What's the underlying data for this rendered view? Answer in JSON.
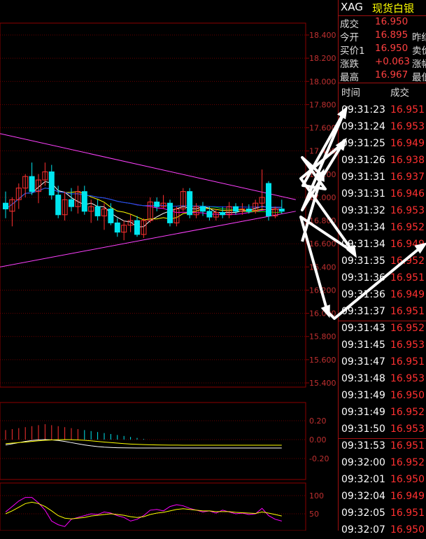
{
  "colors": {
    "background": "#000000",
    "grid": "#8b0000",
    "axis_label": "#c03030",
    "up": "#ff3030",
    "down": "#00e5ee",
    "ma5": "#ffffff",
    "ma10": "#ffff00",
    "ma20": "#ff00ff",
    "ma30": "#00cc00",
    "ma60": "#2040ff",
    "trendline": "#ff40ff",
    "arrow": "#ffffff"
  },
  "quote": {
    "symbol": "XAG",
    "name": "现货白银",
    "rows": [
      {
        "label": "成交",
        "value": "16.950",
        "label2": ""
      },
      {
        "label": "今开",
        "value": "16.895",
        "label2": "昨结"
      },
      {
        "label": "买价1",
        "value": "16.950",
        "label2": "卖价"
      },
      {
        "label": "涨跌",
        "value": "+0.063",
        "label2": "涨幅"
      },
      {
        "label": "最高",
        "value": "16.967",
        "label2": "最低"
      }
    ]
  },
  "ticks": {
    "header_time": "时间",
    "header_price": "成交",
    "rows": [
      {
        "time": "09:31:23",
        "price": "16.951"
      },
      {
        "time": "09:31:24",
        "price": "16.953"
      },
      {
        "time": "09:31:25",
        "price": "16.949"
      },
      {
        "time": "09:31:26",
        "price": "16.938"
      },
      {
        "time": "09:31:31",
        "price": "16.937"
      },
      {
        "time": "09:31:31",
        "price": "16.946"
      },
      {
        "time": "09:31:32",
        "price": "16.953"
      },
      {
        "time": "09:31:34",
        "price": "16.952"
      },
      {
        "time": "09:31:34",
        "price": "16.949"
      },
      {
        "time": "09:31:35",
        "price": "16.952"
      },
      {
        "time": "09:31:36",
        "price": "16.951"
      },
      {
        "time": "09:31:36",
        "price": "16.949"
      },
      {
        "time": "09:31:37",
        "price": "16.951"
      },
      {
        "time": "09:31:43",
        "price": "16.952"
      },
      {
        "time": "09:31:45",
        "price": "16.953"
      },
      {
        "time": "09:31:47",
        "price": "16.951"
      },
      {
        "time": "09:31:48",
        "price": "16.953"
      },
      {
        "time": "09:31:49",
        "price": "16.950"
      },
      {
        "time": "09:31:49",
        "price": "16.952"
      },
      {
        "time": "09:31:50",
        "price": "16.953"
      },
      {
        "time": "09:31:53",
        "price": "16.951"
      },
      {
        "time": "09:32:00",
        "price": "16.952"
      },
      {
        "time": "09:32:01",
        "price": "16.950"
      },
      {
        "time": "09:32:04",
        "price": "16.949"
      },
      {
        "time": "09:32:05",
        "price": "16.951"
      },
      {
        "time": "09:32:07",
        "price": "16.950"
      }
    ]
  },
  "chart_data": [
    {
      "type": "candlestick",
      "title": "",
      "y_ticks": [
        "18.400",
        "18.200",
        "18.000",
        "17.800",
        "17.600",
        "17.400",
        "17.200",
        "17.000",
        "16.800",
        "16.600",
        "16.400",
        "16.200",
        "16.000",
        "15.800",
        "15.600",
        "15.400"
      ],
      "ylim": [
        15.4,
        18.5
      ],
      "candles": [
        {
          "o": 16.95,
          "h": 17.05,
          "l": 16.82,
          "c": 16.9
        },
        {
          "o": 16.88,
          "h": 17.0,
          "l": 16.75,
          "c": 16.98
        },
        {
          "o": 16.98,
          "h": 17.12,
          "l": 16.9,
          "c": 17.08
        },
        {
          "o": 17.08,
          "h": 17.2,
          "l": 17.0,
          "c": 17.18
        },
        {
          "o": 17.18,
          "h": 17.3,
          "l": 17.02,
          "c": 17.05
        },
        {
          "o": 17.05,
          "h": 17.2,
          "l": 16.95,
          "c": 17.15
        },
        {
          "o": 17.15,
          "h": 17.3,
          "l": 17.1,
          "c": 17.22
        },
        {
          "o": 17.22,
          "h": 17.28,
          "l": 16.98,
          "c": 17.02
        },
        {
          "o": 17.02,
          "h": 17.1,
          "l": 16.82,
          "c": 16.85
        },
        {
          "o": 16.85,
          "h": 17.05,
          "l": 16.8,
          "c": 16.98
        },
        {
          "o": 16.98,
          "h": 17.08,
          "l": 16.88,
          "c": 16.92
        },
        {
          "o": 16.92,
          "h": 17.1,
          "l": 16.86,
          "c": 17.05
        },
        {
          "o": 17.05,
          "h": 17.1,
          "l": 16.85,
          "c": 16.88
        },
        {
          "o": 16.88,
          "h": 16.98,
          "l": 16.78,
          "c": 16.92
        },
        {
          "o": 16.92,
          "h": 16.98,
          "l": 16.8,
          "c": 16.84
        },
        {
          "o": 16.84,
          "h": 16.95,
          "l": 16.72,
          "c": 16.9
        },
        {
          "o": 16.9,
          "h": 16.95,
          "l": 16.76,
          "c": 16.78
        },
        {
          "o": 16.78,
          "h": 16.82,
          "l": 16.66,
          "c": 16.7
        },
        {
          "o": 16.7,
          "h": 16.8,
          "l": 16.63,
          "c": 16.76
        },
        {
          "o": 16.76,
          "h": 16.85,
          "l": 16.7,
          "c": 16.8
        },
        {
          "o": 16.8,
          "h": 16.84,
          "l": 16.66,
          "c": 16.68
        },
        {
          "o": 16.68,
          "h": 16.82,
          "l": 16.65,
          "c": 16.8
        },
        {
          "o": 16.8,
          "h": 17.0,
          "l": 16.78,
          "c": 16.96
        },
        {
          "o": 16.96,
          "h": 17.0,
          "l": 16.88,
          "c": 16.92
        },
        {
          "o": 16.92,
          "h": 17.02,
          "l": 16.9,
          "c": 16.95
        },
        {
          "o": 16.95,
          "h": 16.98,
          "l": 16.75,
          "c": 16.78
        },
        {
          "o": 16.78,
          "h": 16.92,
          "l": 16.75,
          "c": 16.9
        },
        {
          "o": 16.9,
          "h": 17.08,
          "l": 16.88,
          "c": 17.05
        },
        {
          "o": 17.05,
          "h": 17.08,
          "l": 16.82,
          "c": 16.85
        },
        {
          "o": 16.85,
          "h": 16.95,
          "l": 16.82,
          "c": 16.92
        },
        {
          "o": 16.92,
          "h": 16.96,
          "l": 16.84,
          "c": 16.88
        },
        {
          "o": 16.88,
          "h": 16.92,
          "l": 16.8,
          "c": 16.83
        },
        {
          "o": 16.83,
          "h": 16.9,
          "l": 16.8,
          "c": 16.87
        },
        {
          "o": 16.87,
          "h": 16.92,
          "l": 16.82,
          "c": 16.85
        },
        {
          "o": 16.85,
          "h": 16.96,
          "l": 16.82,
          "c": 16.92
        },
        {
          "o": 16.92,
          "h": 16.95,
          "l": 16.85,
          "c": 16.88
        },
        {
          "o": 16.88,
          "h": 16.95,
          "l": 16.85,
          "c": 16.9
        },
        {
          "o": 16.9,
          "h": 16.94,
          "l": 16.86,
          "c": 16.88
        },
        {
          "o": 16.88,
          "h": 16.98,
          "l": 16.86,
          "c": 16.95
        },
        {
          "o": 16.95,
          "h": 17.24,
          "l": 16.9,
          "c": 17.0
        },
        {
          "o": 17.12,
          "h": 17.14,
          "l": 16.8,
          "c": 16.84
        },
        {
          "o": 16.84,
          "h": 16.92,
          "l": 16.82,
          "c": 16.9
        },
        {
          "o": 16.9,
          "h": 16.98,
          "l": 16.86,
          "c": 16.88
        }
      ],
      "trendlines": [
        {
          "from": [
            0,
            17.55
          ],
          "to": [
            42,
            16.98
          ]
        },
        {
          "from": [
            0,
            16.4
          ],
          "to": [
            42,
            16.88
          ]
        }
      ]
    },
    {
      "type": "line",
      "title": "",
      "y_ticks": [
        "0.20",
        "0.00",
        "-0.20"
      ],
      "ylim": [
        -0.3,
        0.3
      ]
    },
    {
      "type": "line",
      "title": "",
      "y_ticks": [
        "100",
        "50"
      ],
      "ylim": [
        0,
        100
      ]
    }
  ]
}
